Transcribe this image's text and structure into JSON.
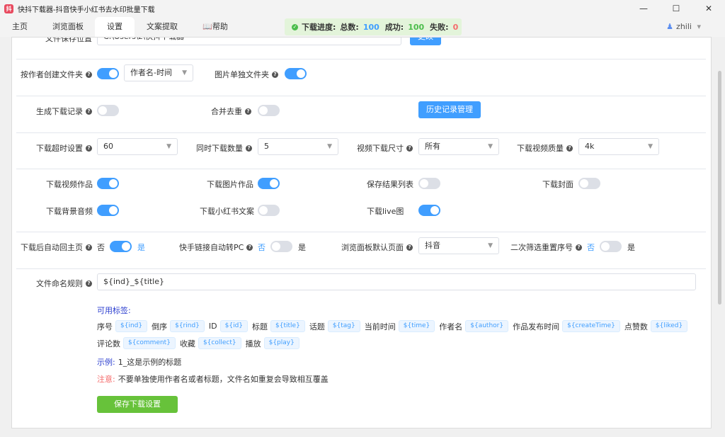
{
  "window": {
    "title": "快抖下载器-抖音快手小红书去水印批量下载",
    "app_icon_glyph": "抖",
    "controls": {
      "minimize": "—",
      "maximize": "☐",
      "close": "✕"
    }
  },
  "tabs": [
    {
      "label": "主页"
    },
    {
      "label": "浏览面板"
    },
    {
      "label": "设置"
    },
    {
      "label": "文案提取"
    },
    {
      "label": "📖帮助"
    }
  ],
  "progress": {
    "label": "下载进度:",
    "total_label": "总数:",
    "total": "100",
    "success_label": "成功:",
    "success": "100",
    "fail_label": "失败:",
    "fail": "0"
  },
  "user": {
    "name": "zhili",
    "caret": "▾"
  },
  "settings": {
    "save_path": {
      "label": "文件保存位置",
      "value": "C:\\Users\\z\\快抖下载器",
      "button": "更改"
    },
    "author_folder": {
      "label": "按作者创建文件夹",
      "select": "作者名-时间"
    },
    "image_folder": {
      "label": "图片单独文件夹"
    },
    "download_record": {
      "label": "生成下载记录"
    },
    "dedupe": {
      "label": "合并去重"
    },
    "history_button": "历史记录管理",
    "timeout": {
      "label": "下载超时设置",
      "value": "60"
    },
    "concurrency": {
      "label": "同时下载数量",
      "value": "5"
    },
    "video_size": {
      "label": "视频下载尺寸",
      "value": "所有"
    },
    "video_quality": {
      "label": "下载视频质量",
      "value": "4k"
    },
    "dl_video": {
      "label": "下载视频作品"
    },
    "dl_image": {
      "label": "下载图片作品"
    },
    "save_list": {
      "label": "保存结果列表"
    },
    "dl_cover": {
      "label": "下载封面"
    },
    "dl_bgm": {
      "label": "下载背景音频"
    },
    "dl_xhs_text": {
      "label": "下载小红书文案"
    },
    "dl_live": {
      "label": "下载live图"
    },
    "auto_home": {
      "label": "下载后自动回主页",
      "no": "否",
      "yes": "是"
    },
    "ks_to_pc": {
      "label": "快手链接自动转PC",
      "no": "否",
      "yes": "是"
    },
    "browse_default": {
      "label": "浏览面板默认页面",
      "value": "抖音"
    },
    "reseq": {
      "label": "二次筛选重置序号",
      "no": "否",
      "yes": "是"
    },
    "naming": {
      "label": "文件命名规则",
      "value": "${ind}_${title}"
    }
  },
  "tags": {
    "heading": "可用标签:",
    "row1": [
      {
        "name": "序号",
        "tag": "${ind}"
      },
      {
        "name": "倒序",
        "tag": "${rind}"
      },
      {
        "name": "ID",
        "tag": "${id}"
      },
      {
        "name": "标题",
        "tag": "${title}"
      },
      {
        "name": "话题",
        "tag": "${tag}"
      },
      {
        "name": "当前时间",
        "tag": "${time}"
      },
      {
        "name": "作者名",
        "tag": "${author}"
      },
      {
        "name": "作品发布时间",
        "tag": "${createTime}"
      },
      {
        "name": "点赞数",
        "tag": "${liked}"
      }
    ],
    "row2": [
      {
        "name": "评论数",
        "tag": "${comment}"
      },
      {
        "name": "收藏",
        "tag": "${collect}"
      },
      {
        "name": "播放",
        "tag": "${play}"
      }
    ],
    "example_label": "示例:",
    "example_value": "1_这是示例的标题",
    "note_label": "注意:",
    "note_value": "不要单独使用作者名或者标题，文件名如重复会导致相互覆盖"
  },
  "save_button": "保存下载设置",
  "toggles": {
    "author_folder": true,
    "image_folder": true,
    "download_record": false,
    "dedupe": false,
    "dl_video": true,
    "dl_image": true,
    "save_list": false,
    "dl_cover": false,
    "dl_bgm": true,
    "dl_xhs_text": false,
    "dl_live": true,
    "auto_home": true,
    "ks_to_pc": false,
    "reseq": false
  },
  "colors": {
    "primary": "#409eff",
    "success": "#67c23a",
    "danger": "#f56c6c"
  }
}
